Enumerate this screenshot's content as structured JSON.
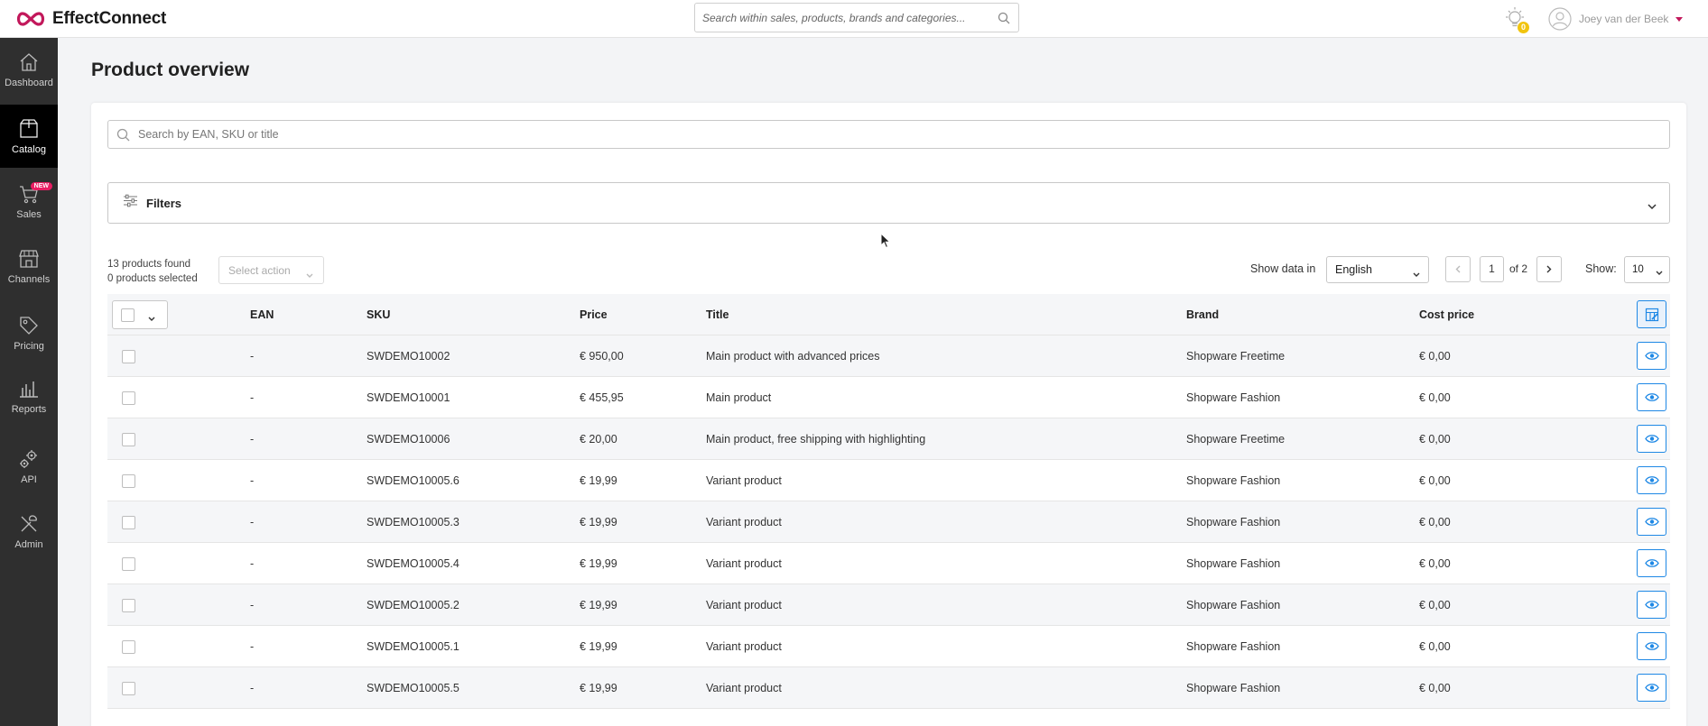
{
  "app": {
    "logo_text": "EffectConnect",
    "global_search_placeholder": "Search within sales, products, brands and categories...",
    "notification_count": "0",
    "user_name": "Joey van der Beek",
    "accent_color": "#c2185b",
    "link_color": "#1e88e5"
  },
  "sidebar": {
    "items": [
      {
        "label": "Dashboard",
        "icon": "home-icon"
      },
      {
        "label": "Catalog",
        "icon": "box-icon",
        "active": true
      },
      {
        "label": "Sales",
        "icon": "cart-icon",
        "badge": "NEW"
      },
      {
        "label": "Channels",
        "icon": "store-icon"
      },
      {
        "label": "Pricing",
        "icon": "tag-icon"
      },
      {
        "label": "Reports",
        "icon": "bar-chart-icon"
      },
      {
        "label": "API",
        "icon": "gears-icon"
      },
      {
        "label": "Admin",
        "icon": "tools-icon"
      }
    ]
  },
  "page": {
    "title": "Product overview",
    "search_placeholder": "Search by EAN, SKU or title",
    "filters_label": "Filters",
    "products_found": "13 products found",
    "products_selected": "0 products selected",
    "select_action_placeholder": "Select action",
    "show_data_label": "Show data in",
    "language": "English",
    "page_current": "1",
    "page_of": "of 2",
    "show_label": "Show:",
    "show_value": "10"
  },
  "table": {
    "headers": {
      "ean": "EAN",
      "sku": "SKU",
      "price": "Price",
      "title": "Title",
      "brand": "Brand",
      "cost": "Cost price"
    },
    "rows": [
      {
        "ean": "-",
        "sku": "SWDEMO10002",
        "price": "€ 950,00",
        "title": "Main product with advanced prices",
        "brand": "Shopware Freetime",
        "cost": "€ 0,00"
      },
      {
        "ean": "-",
        "sku": "SWDEMO10001",
        "price": "€ 455,95",
        "title": "Main product",
        "brand": "Shopware Fashion",
        "cost": "€ 0,00"
      },
      {
        "ean": "-",
        "sku": "SWDEMO10006",
        "price": "€ 20,00",
        "title": "Main product, free shipping with highlighting",
        "brand": "Shopware Freetime",
        "cost": "€ 0,00"
      },
      {
        "ean": "-",
        "sku": "SWDEMO10005.6",
        "price": "€ 19,99",
        "title": "Variant product",
        "brand": "Shopware Fashion",
        "cost": "€ 0,00"
      },
      {
        "ean": "-",
        "sku": "SWDEMO10005.3",
        "price": "€ 19,99",
        "title": "Variant product",
        "brand": "Shopware Fashion",
        "cost": "€ 0,00"
      },
      {
        "ean": "-",
        "sku": "SWDEMO10005.4",
        "price": "€ 19,99",
        "title": "Variant product",
        "brand": "Shopware Fashion",
        "cost": "€ 0,00"
      },
      {
        "ean": "-",
        "sku": "SWDEMO10005.2",
        "price": "€ 19,99",
        "title": "Variant product",
        "brand": "Shopware Fashion",
        "cost": "€ 0,00"
      },
      {
        "ean": "-",
        "sku": "SWDEMO10005.1",
        "price": "€ 19,99",
        "title": "Variant product",
        "brand": "Shopware Fashion",
        "cost": "€ 0,00"
      },
      {
        "ean": "-",
        "sku": "SWDEMO10005.5",
        "price": "€ 19,99",
        "title": "Variant product",
        "brand": "Shopware Fashion",
        "cost": "€ 0,00"
      }
    ]
  }
}
